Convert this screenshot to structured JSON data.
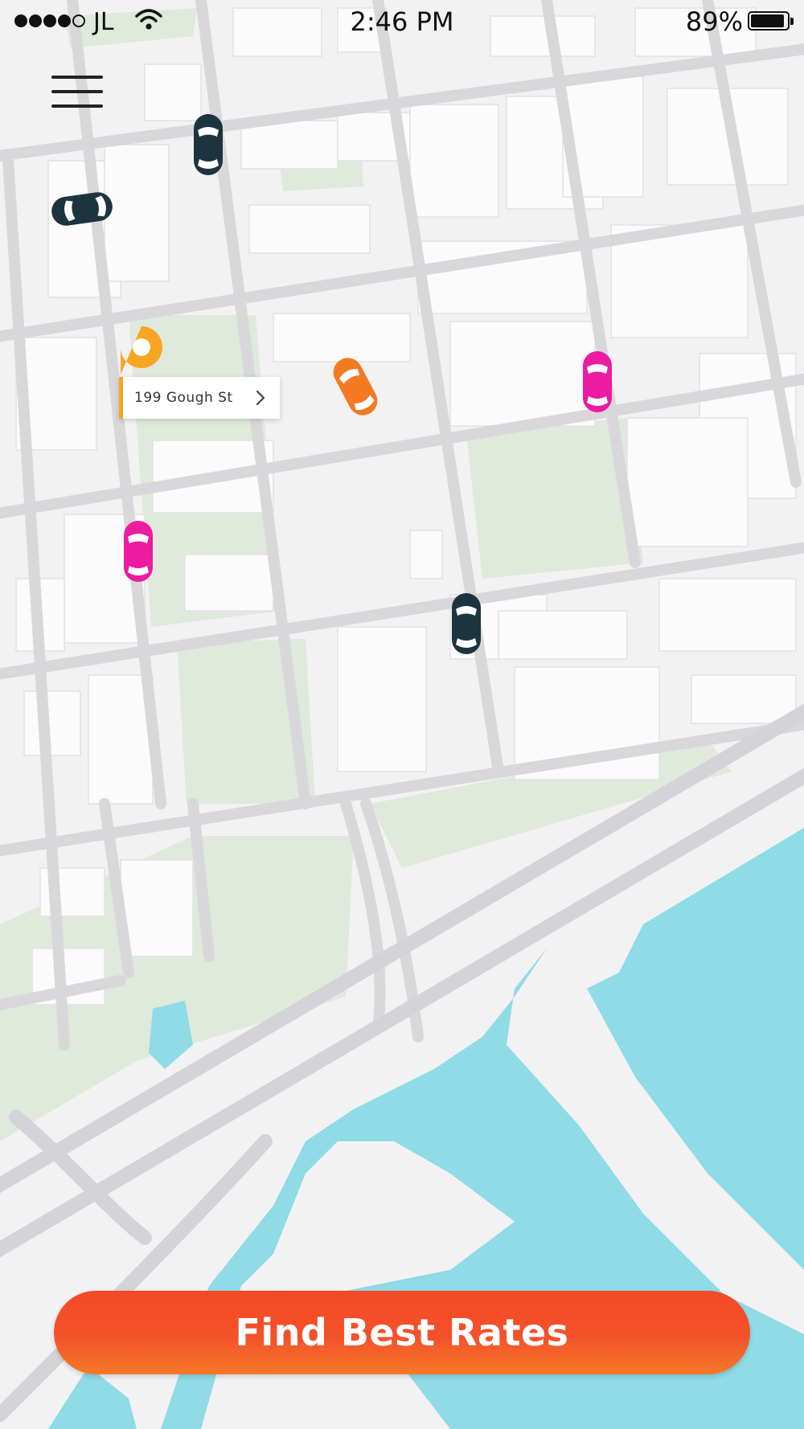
{
  "status_bar": {
    "carrier": "JL",
    "time": "2:46 PM",
    "battery_percent": "89%",
    "signal_bars_filled": 4,
    "signal_bars_total": 5
  },
  "map": {
    "pickup": {
      "address": "199 Gough St",
      "pin_color": "#f7a623",
      "chevron_icon": "chevron-right-icon"
    },
    "cars": [
      {
        "service": "dark",
        "color": "#1b3440"
      },
      {
        "service": "dark",
        "color": "#1b3440"
      },
      {
        "service": "orange",
        "color": "#f47a22"
      },
      {
        "service": "pink",
        "color": "#ec1ba0"
      },
      {
        "service": "pink",
        "color": "#ec1ba0"
      },
      {
        "service": "dark",
        "color": "#1b3440"
      }
    ]
  },
  "menu": {
    "icon": "hamburger-menu-icon"
  },
  "action": {
    "label": "Find Best Rates",
    "color": "#f34a25"
  }
}
